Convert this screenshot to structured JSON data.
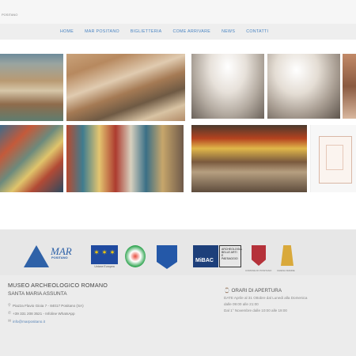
{
  "topbar": {
    "crumb": "POSITANO"
  },
  "nav": {
    "items": [
      "HOME",
      "MAR POSITANO",
      "BIGLIETTERIA",
      "COME ARRIVARE",
      "NEWS",
      "CONTATTI"
    ]
  },
  "gallery": {
    "photos": [
      {
        "name": "photo-positano-aerial"
      },
      {
        "name": "photo-excavation-tunnel"
      },
      {
        "name": "photo-vaulted-crypt-1"
      },
      {
        "name": "photo-vaulted-crypt-2"
      },
      {
        "name": "photo-fresco-edge"
      },
      {
        "name": "photo-fresco-wall-1"
      },
      {
        "name": "photo-fresco-wall-2"
      },
      {
        "name": "photo-excavation-site"
      },
      {
        "name": "photo-floor-plan"
      }
    ]
  },
  "logos": {
    "mar_title": "MAR",
    "mar_sub": "POSITANO",
    "eu_label": "Unione Europea",
    "mibac": "MiBAC",
    "arch_text": "ARCHEOLOGIA BELLE ARTI E PAESAGGIO",
    "comune_label": "COMUNE DI POSITANO",
    "chiesa_label": "CHIESA MADRE"
  },
  "footer": {
    "museum_name": "MUSEO ARCHEOLOGICO ROMANO",
    "museum_sub": "SANTA MARIA ASSUNTA",
    "address": "Piazza Flavio Gioia 7 - 84017 Positano (SA)",
    "phone": "+39 331 208 3521 - Infoline WhatsApp",
    "email": "info@marpositano.it",
    "hours_title": "ORARI DI APERTURA",
    "hours_line1": "DATE Aprile al 31 Ottobre dal Lunedi alla Domenica",
    "hours_line2": "dalle 09:00 alle 21:00",
    "hours_line3": "Dal 1° Novembre dalle 10:00 alle 19:00"
  },
  "colors": {
    "nav_text": "#4a84c2",
    "footer_bg": "#ececec",
    "brand_blue": "#2f62a8"
  }
}
